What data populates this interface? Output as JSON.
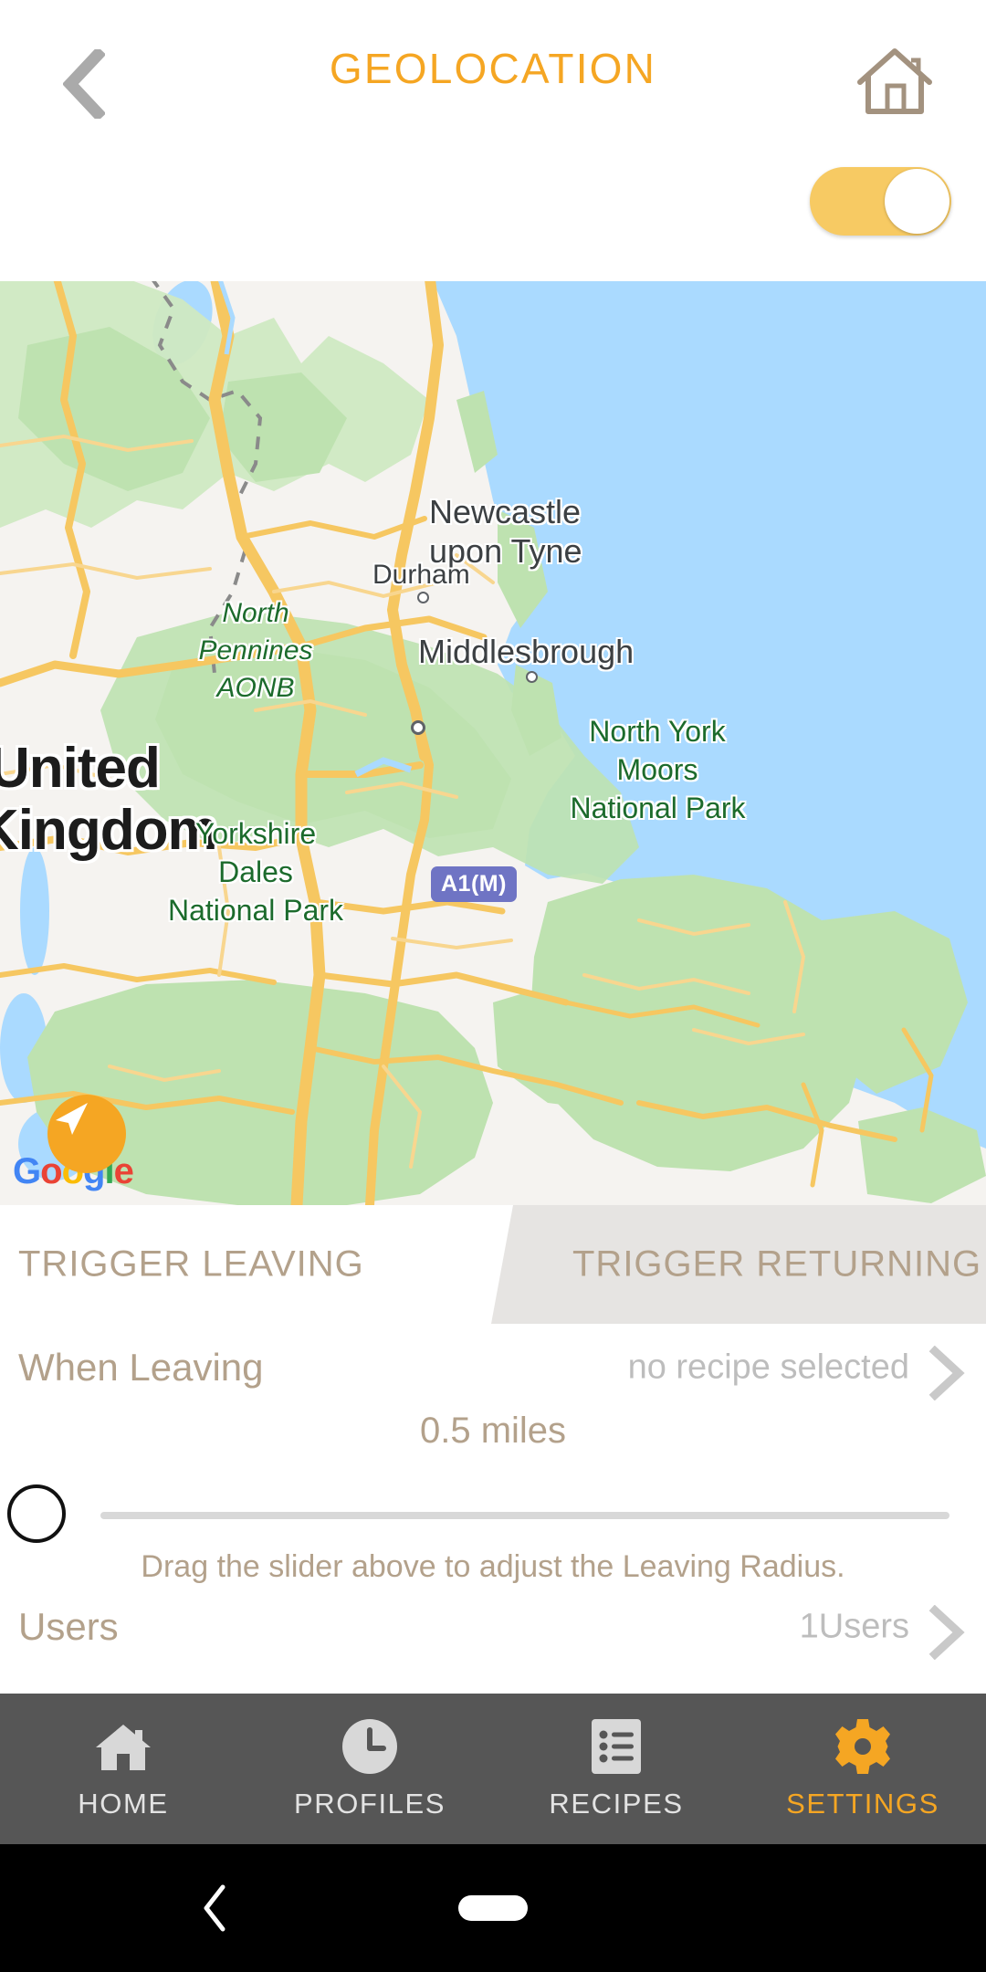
{
  "header": {
    "title": "GEOLOCATION",
    "back_icon": "chevron-left-icon",
    "home_icon": "home-outline-icon",
    "toggle": {
      "state": "on",
      "color": "#F7CA63"
    }
  },
  "map": {
    "provider_logo": "Google",
    "provider_letters": [
      "G",
      "o",
      "o",
      "g",
      "l",
      "e"
    ],
    "locate_icon": "navigation-arrow-icon",
    "road_shield": "A1(M)",
    "labels": [
      {
        "text": "United",
        "type": "country"
      },
      {
        "text": "Kingdom",
        "type": "country"
      },
      {
        "text": "Newcastle",
        "type": "city"
      },
      {
        "text": "upon Tyne",
        "type": "city"
      },
      {
        "text": "Durham",
        "type": "city"
      },
      {
        "text": "Middlesbrough",
        "type": "city"
      },
      {
        "text": "North Pennines AONB",
        "type": "park"
      },
      {
        "text": "North York Moors National Park",
        "type": "park"
      },
      {
        "text": "Yorkshire Dales National Park",
        "type": "park"
      }
    ],
    "country_line1": "United",
    "country_line2": "Kingdom",
    "city_newcastle_l1": "Newcastle",
    "city_newcastle_l2": "upon Tyne",
    "city_durham": "Durham",
    "city_middlesbrough": "Middlesbrough",
    "park_pennines_l1": "North",
    "park_pennines_l2": "Pennines",
    "park_pennines_l3": "AONB",
    "park_nymoors_l1": "North York",
    "park_nymoors_l2": "Moors",
    "park_nymoors_l3": "National Park",
    "park_dales_l1": "Yorkshire",
    "park_dales_l2": "Dales",
    "park_dales_l3": "National Park",
    "colors": {
      "sea": "#AADAFF",
      "land": "#F5F3F0",
      "park": "#BEE2B0",
      "road": "#F6C761"
    }
  },
  "tabs": {
    "active_index": 0,
    "items": [
      {
        "label": "TRIGGER LEAVING",
        "active": true
      },
      {
        "label": "TRIGGER RETURNING",
        "active": false
      }
    ],
    "leaving_label": "TRIGGER LEAVING",
    "returning_label": "TRIGGER RETURNING"
  },
  "settings": {
    "when_leaving": {
      "label": "When Leaving",
      "value": "no recipe selected",
      "chevron": "chevron-right-icon"
    },
    "radius": {
      "value_text": "0.5 miles",
      "value_number": 0.5,
      "unit": "miles",
      "slider_position_percent": 0,
      "hint": "Drag the slider above to adjust the Leaving Radius."
    },
    "users": {
      "label": "Users",
      "value": "1Users",
      "chevron": "chevron-right-icon"
    }
  },
  "bottom_nav": {
    "items": [
      {
        "label": "HOME",
        "icon": "home-filled-icon",
        "active": false
      },
      {
        "label": "PROFILES",
        "icon": "clock-icon",
        "active": false
      },
      {
        "label": "RECIPES",
        "icon": "list-document-icon",
        "active": false
      },
      {
        "label": "SETTINGS",
        "icon": "gear-icon",
        "active": true
      }
    ],
    "active_color": "#F5A623",
    "inactive_color": "#E3E3E3"
  },
  "system_nav": {
    "back_icon": "chevron-left-icon",
    "home_icon": "home-pill-icon"
  }
}
